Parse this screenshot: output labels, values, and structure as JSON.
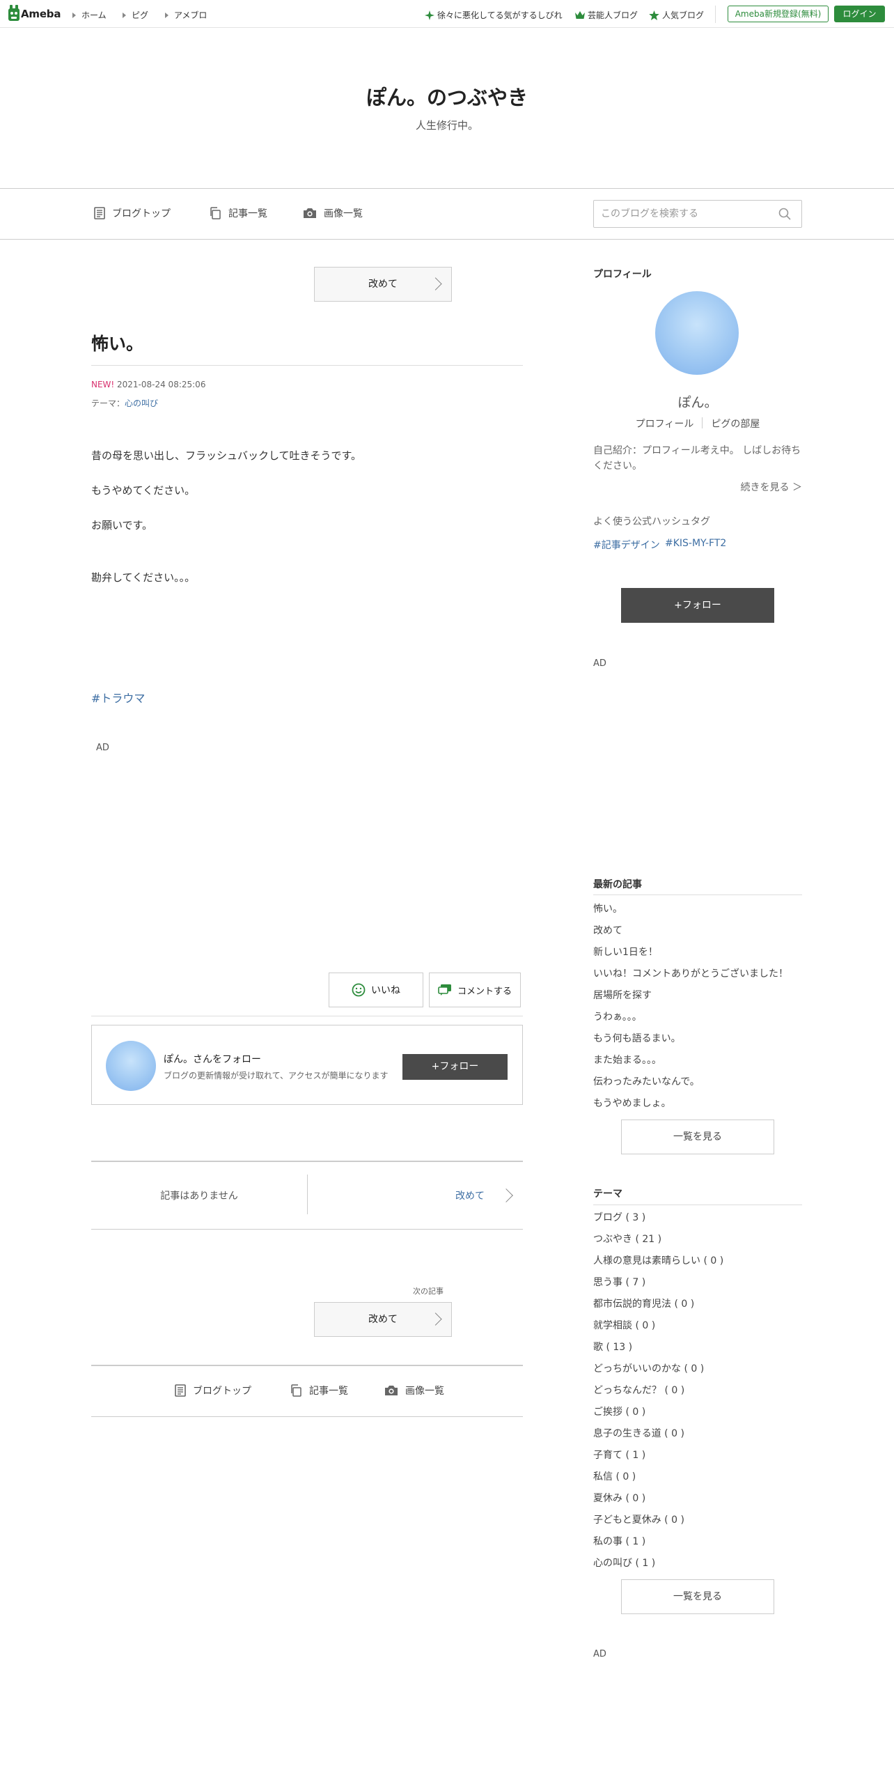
{
  "topbar": {
    "logo": "Ameba",
    "nav": [
      "ホーム",
      "ピグ",
      "アメブロ"
    ],
    "trending": "徐々に悪化してる気がするしびれ",
    "celebrity": "芸能人ブログ",
    "popular": "人気ブログ",
    "register": "Ameba新規登録(無料)",
    "login": "ログイン",
    "accent": "#2d8c3c"
  },
  "header": {
    "title": "ぽん。のつぶやき",
    "description": "人生修行中。"
  },
  "nav": {
    "blog_top": "ブログトップ",
    "entry_list": "記事一覧",
    "image_list": "画像一覧",
    "search_placeholder": "このブログを検索する"
  },
  "article": {
    "prev_button": "改めて",
    "title": "怖い。",
    "new_badge": "NEW!",
    "date": "2021-08-24 08:25:06",
    "theme_label": "テーマ：",
    "theme": "心の叫び",
    "paragraphs": [
      "昔の母を思い出し、フラッシュバックして吐きそうです。",
      "もうやめてください。",
      "お願いです。",
      "勘弁してください。。。"
    ],
    "hashtag": "#トラウマ",
    "ad": "AD",
    "like": "いいね",
    "comment": "コメントする",
    "follow_name": "ぽん。さんをフォロー",
    "follow_desc": "ブログの更新情報が受け取れて、アクセスが簡単になります",
    "follow_button": "フォロー",
    "pager_prev": "記事はありません",
    "pager_next": "改めて",
    "next_label": "次の記事",
    "next_button": "改めて"
  },
  "sidebar": {
    "profile_heading": "プロフィール",
    "name": "ぽん。",
    "profile_link": "プロフィール",
    "pig_link": "ピグの部屋",
    "intro": "自己紹介：プロフィール考え中。 しばしお待ちください。",
    "more": "続きを見る ＞",
    "hashtag_heading": "よく使う公式ハッシュタグ",
    "tags": [
      "#記事デザイン",
      "#KIS-MY-FT2"
    ],
    "follow_button": "フォロー",
    "ad1": "AD",
    "recent_heading": "最新の記事",
    "recent": [
      "怖い。",
      "改めて",
      "新しい1日を！",
      "いいね！コメントありがとうございました！",
      "居場所を探す",
      "うわぁ。。。",
      "もう何も語るまい。",
      "また始まる。。。",
      "伝わったみたいなんで。",
      "もうやめましょ。"
    ],
    "recent_more": "一覧を見る",
    "theme_heading": "テーマ",
    "themes": [
      "ブログ ( 3 )",
      "つぶやき ( 21 )",
      "人様の意見は素晴らしい ( 0 )",
      "思う事 ( 7 )",
      "都市伝説的育児法 ( 0 )",
      "就学相談 ( 0 )",
      "歌 ( 13 )",
      "どっちがいいのかな ( 0 )",
      "どっちなんだ？ ( 0 )",
      "ご挨拶 ( 0 )",
      "息子の生きる道 ( 0 )",
      "子育て ( 1 )",
      "私信 ( 0 )",
      "夏休み ( 0 )",
      "子どもと夏休み ( 0 )",
      "私の事 ( 1 )",
      "心の叫び ( 1 )"
    ],
    "theme_more": "一覧を見る",
    "ad2": "AD"
  }
}
